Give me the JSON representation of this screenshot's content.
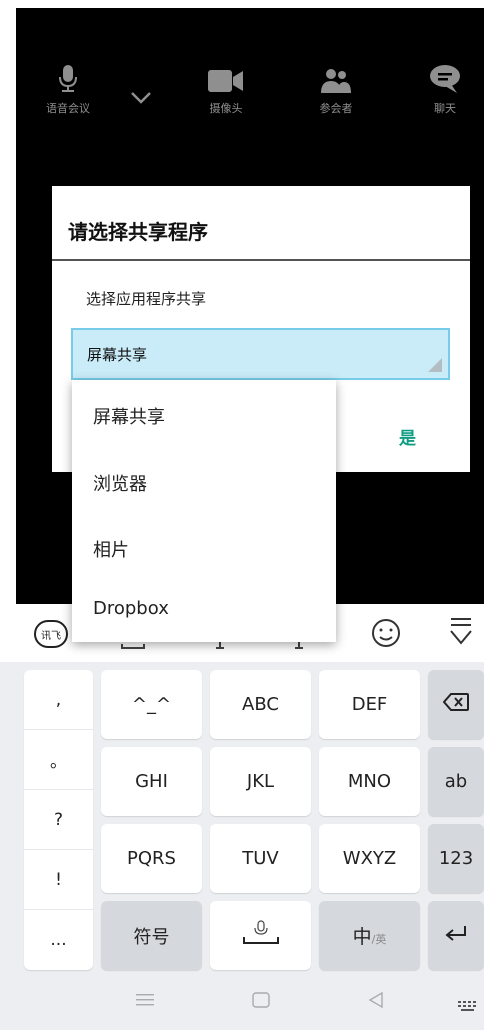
{
  "meeting_toolbar": {
    "voice_label": "语音会议",
    "camera_label": "摄像头",
    "participants_label": "参会者",
    "chat_label": "聊天"
  },
  "dialog": {
    "title": "请选择共享程序",
    "subtitle": "选择应用程序共享",
    "selected_value": "屏幕共享",
    "confirm_label": "是"
  },
  "dropdown": {
    "options": [
      "屏幕共享",
      "浏览器",
      "相片",
      "Dropbox"
    ]
  },
  "keyboard": {
    "logo_text": "讯飞",
    "punctuation": [
      ",",
      "。",
      "?",
      "!",
      "..."
    ],
    "keys": {
      "emoticon": "^_^",
      "abc": "ABC",
      "def": "DEF",
      "ghi": "GHI",
      "jkl": "JKL",
      "mno": "MNO",
      "ab_mode": "ab",
      "pqrs": "PQRS",
      "tuv": "TUV",
      "wxyz": "WXYZ",
      "num_mode": "123",
      "symbols": "符号",
      "lang_main": "中",
      "lang_alt": "/英"
    }
  },
  "colors": {
    "accent": "#119c84",
    "select_bg": "#c9ecf8",
    "select_border": "#77cde9",
    "keyboard_bg": "#eceef1"
  },
  "icons": {
    "voice": "microphone-icon",
    "toggle": "chevron-down-icon",
    "camera": "video-camera-icon",
    "participants": "people-icon",
    "chat": "chat-bubble-icon",
    "backspace": "backspace-icon",
    "enter": "enter-icon",
    "space": "space-mic-icon"
  }
}
